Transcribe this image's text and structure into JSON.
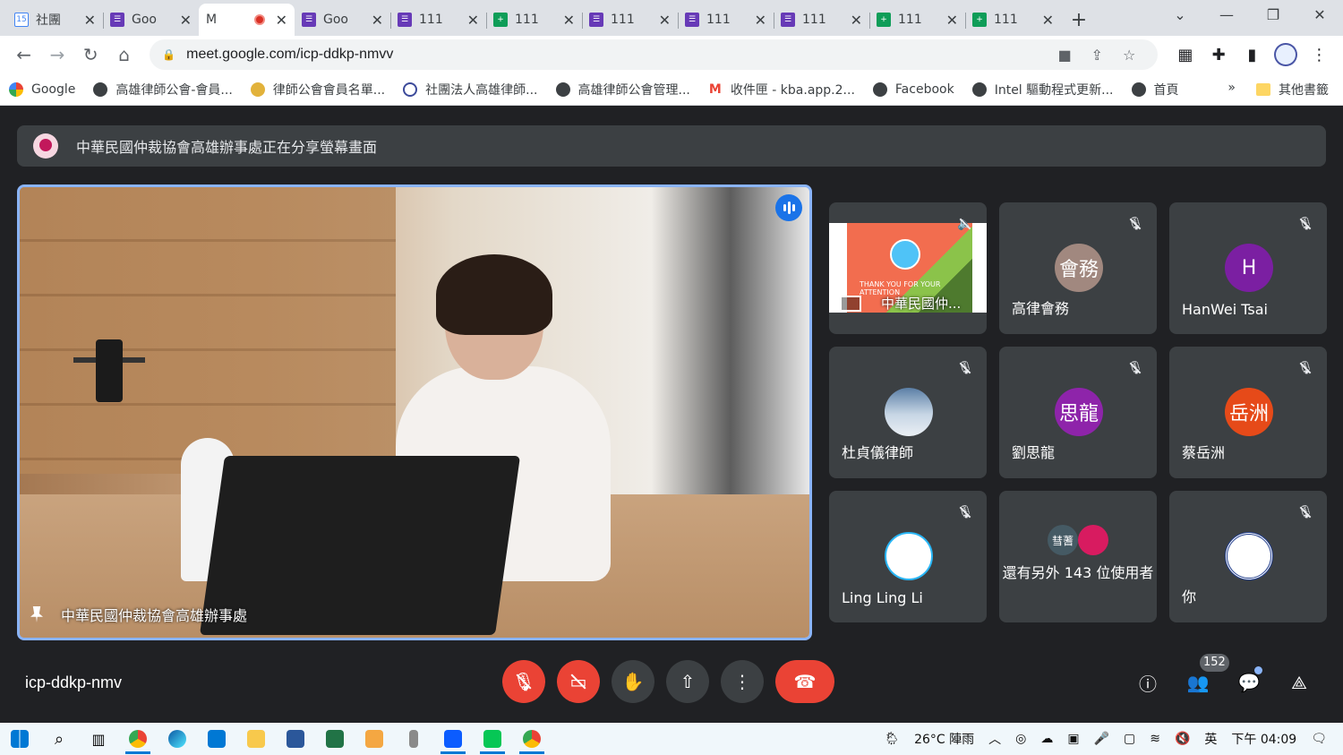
{
  "tabs": [
    {
      "label": "社團",
      "icon": "calendar-icon",
      "kind": "cal"
    },
    {
      "label": "Goo",
      "icon": "forms-icon",
      "kind": "forms"
    },
    {
      "label": "M",
      "icon": "meet-icon",
      "kind": "meet",
      "active": true,
      "recording": true
    },
    {
      "label": "Goo",
      "icon": "forms-icon",
      "kind": "forms"
    },
    {
      "label": "111",
      "icon": "forms-icon",
      "kind": "forms"
    },
    {
      "label": "111",
      "icon": "sheets-icon",
      "kind": "sheets"
    },
    {
      "label": "111",
      "icon": "forms-icon",
      "kind": "forms"
    },
    {
      "label": "111",
      "icon": "forms-icon",
      "kind": "forms"
    },
    {
      "label": "111",
      "icon": "forms-icon",
      "kind": "forms"
    },
    {
      "label": "111",
      "icon": "sheets-icon",
      "kind": "sheets"
    },
    {
      "label": "111",
      "icon": "sheets-icon",
      "kind": "sheets"
    }
  ],
  "calendar_tab_badge": "15",
  "address_bar": {
    "url": "meet.google.com/icp-ddkp-nmvv"
  },
  "bookmarks": [
    {
      "label": "Google",
      "icon": "google-icon"
    },
    {
      "label": "高雄律師公會-會員...",
      "icon": "globe-icon"
    },
    {
      "label": "律師公會會員名單...",
      "icon": "emblem-icon"
    },
    {
      "label": "社團法人高雄律師...",
      "icon": "seal-icon"
    },
    {
      "label": "高雄律師公會管理...",
      "icon": "globe-icon"
    },
    {
      "label": "收件匣 - kba.app.2...",
      "icon": "gmail-icon"
    },
    {
      "label": "Facebook",
      "icon": "globe-icon"
    },
    {
      "label": "Intel 驅動程式更新...",
      "icon": "globe-icon"
    },
    {
      "label": "首頁",
      "icon": "globe-icon"
    }
  ],
  "bookmarks_more": "»",
  "bookmarks_other": "其他書籤",
  "banner": {
    "text": "中華民國仲裁協會高雄辦事處正在分享螢幕畫面"
  },
  "main_video": {
    "name": "中華民國仲裁協會高雄辦事處"
  },
  "participants": [
    {
      "name": "中華民國仲...",
      "type": "screen",
      "slide_text": "THANK YOU FOR YOUR ATTENTION"
    },
    {
      "name": "高律會務",
      "avatar_text": "會務",
      "avatar_color": "#a1887f"
    },
    {
      "name": "HanWei Tsai",
      "avatar_text": "H",
      "avatar_color": "#7b1fa2"
    },
    {
      "name": "杜貞儀律師",
      "avatar_text": "",
      "avatar_color": "#90a4ae"
    },
    {
      "name": "劉思龍",
      "avatar_text": "思龍",
      "avatar_color": "#8e24aa"
    },
    {
      "name": "蔡岳洲",
      "avatar_text": "岳洲",
      "avatar_color": "#e64a19"
    },
    {
      "name": "Ling Ling Li",
      "avatar_text": "",
      "avatar_color": "#29b6f6"
    },
    {
      "name": "還有另外 143 位使用者",
      "type": "others",
      "dot_text": "彗蓍"
    },
    {
      "name": "你",
      "avatar_text": "",
      "avatar_color": "#ffffff"
    }
  ],
  "meeting_code": "icp-ddkp-nmv",
  "people_count": "152",
  "taskbar": {
    "weather": "26°C 陣雨",
    "ime": "英",
    "clock": "下午 04:09"
  }
}
